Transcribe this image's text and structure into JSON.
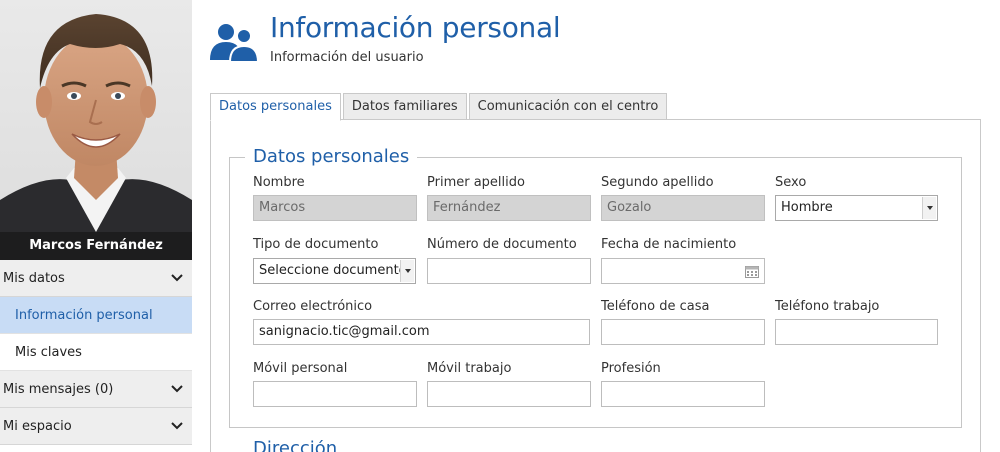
{
  "user": {
    "name": "Marcos Fernández"
  },
  "sidebar": {
    "sections": [
      {
        "label": "Mis datos",
        "expanded": true,
        "items": [
          {
            "label": "Información personal",
            "active": true
          },
          {
            "label": "Mis claves",
            "active": false
          }
        ]
      },
      {
        "label": "Mis mensajes (0)",
        "expanded": false
      },
      {
        "label": "Mi espacio",
        "expanded": false
      }
    ]
  },
  "header": {
    "title": "Información personal",
    "subtitle": "Información del usuario",
    "icon": "users-icon"
  },
  "tabs": [
    {
      "label": "Datos personales",
      "active": true
    },
    {
      "label": "Datos familiares",
      "active": false
    },
    {
      "label": "Comunicación con el centro",
      "active": false
    }
  ],
  "form": {
    "legend": "Datos personales",
    "next_legend": "Dirección",
    "fields": {
      "nombre": {
        "label": "Nombre",
        "value": "Marcos",
        "disabled": true
      },
      "primer_apellido": {
        "label": "Primer apellido",
        "value": "Fernández",
        "disabled": true
      },
      "segundo_apellido": {
        "label": "Segundo apellido",
        "value": "Gozalo",
        "disabled": true
      },
      "sexo": {
        "label": "Sexo",
        "value": "Hombre"
      },
      "tipo_documento": {
        "label": "Tipo de documento",
        "value": "Seleccione documento"
      },
      "numero_documento": {
        "label": "Número de documento",
        "value": ""
      },
      "fecha_nacimiento": {
        "label": "Fecha de nacimiento",
        "value": ""
      },
      "correo": {
        "label": "Correo electrónico",
        "value": "sanignacio.tic@gmail.com"
      },
      "telefono_casa": {
        "label": "Teléfono de casa",
        "value": ""
      },
      "telefono_trabajo": {
        "label": "Teléfono trabajo",
        "value": ""
      },
      "movil_personal": {
        "label": "Móvil personal",
        "value": ""
      },
      "movil_trabajo": {
        "label": "Móvil trabajo",
        "value": ""
      },
      "profesion": {
        "label": "Profesión",
        "value": ""
      }
    }
  },
  "colors": {
    "accent": "#1f5fa8",
    "active_menu_bg": "#c8dcf5",
    "disabled_bg": "#d4d4d4"
  }
}
